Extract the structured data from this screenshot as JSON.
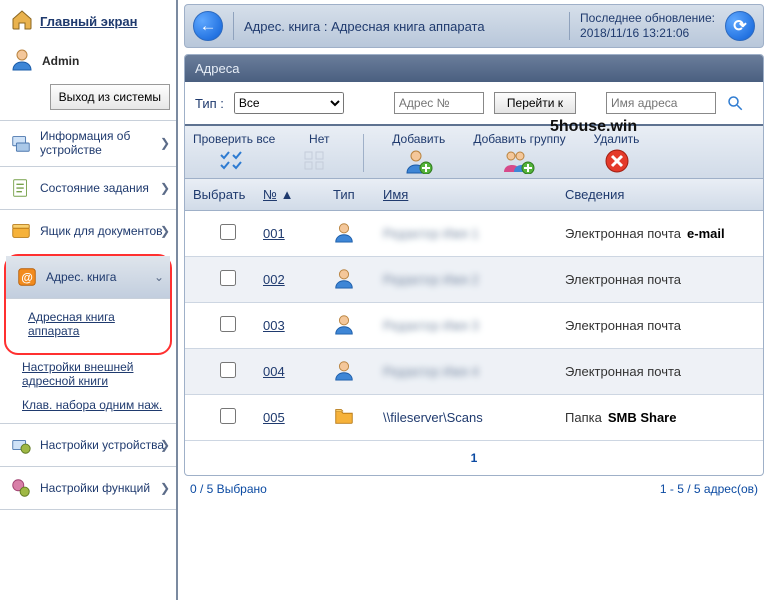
{
  "sidebar": {
    "home": "Главный экран",
    "user": "Admin",
    "logout": "Выход из системы",
    "items": [
      {
        "label": "Информация об устройстве"
      },
      {
        "label": "Состояние задания"
      },
      {
        "label": "Ящик для документов"
      },
      {
        "label": "Адрес. книга"
      },
      {
        "label": "Настройки устройства"
      },
      {
        "label": "Настройки функций"
      }
    ],
    "subitems": [
      "Адресная книга аппарата",
      "Настройки внешней адресной книги",
      "Клав. набора одним наж."
    ]
  },
  "header": {
    "crumb1": "Адрес. книга",
    "crumb2": "Адресная книга аппарата",
    "upd_label": "Последнее обновление:",
    "upd_time": "2018/11/16 13:21:06"
  },
  "watermark": "5house.win",
  "panel": {
    "title": "Адреса",
    "type_label": "Тип :",
    "type_value": "Все",
    "addr_no_ph": "Адрес №",
    "goto": "Перейти к",
    "name_ph": "Имя адреса"
  },
  "actions": {
    "check_all": "Проверить все",
    "none": "Нет",
    "add": "Добавить",
    "add_group": "Добавить группу",
    "delete": "Удалить"
  },
  "columns": {
    "select": "Выбрать",
    "no": "№",
    "type": "Тип",
    "name": "Имя",
    "details": "Сведения"
  },
  "rows": [
    {
      "no": "001",
      "name": "Редактор Имя 1",
      "details": "Электронная почта",
      "kind": "person",
      "annot": "e-mail"
    },
    {
      "no": "002",
      "name": "Редактор Имя 2",
      "details": "Электронная почта",
      "kind": "person",
      "annot": ""
    },
    {
      "no": "003",
      "name": "Редактор Имя 3",
      "details": "Электронная почта",
      "kind": "person",
      "annot": ""
    },
    {
      "no": "004",
      "name": "Редактор Имя 4",
      "details": "Электронная почта",
      "kind": "person",
      "annot": ""
    },
    {
      "no": "005",
      "name": "\\\\fileserver\\Scans",
      "details": "Папка",
      "kind": "folder",
      "annot": "SMB Share"
    }
  ],
  "pager": {
    "page": "1"
  },
  "footer": {
    "selected": "0 / 5 Выбрано",
    "range": "1 - 5 / 5 адрес(ов)"
  }
}
